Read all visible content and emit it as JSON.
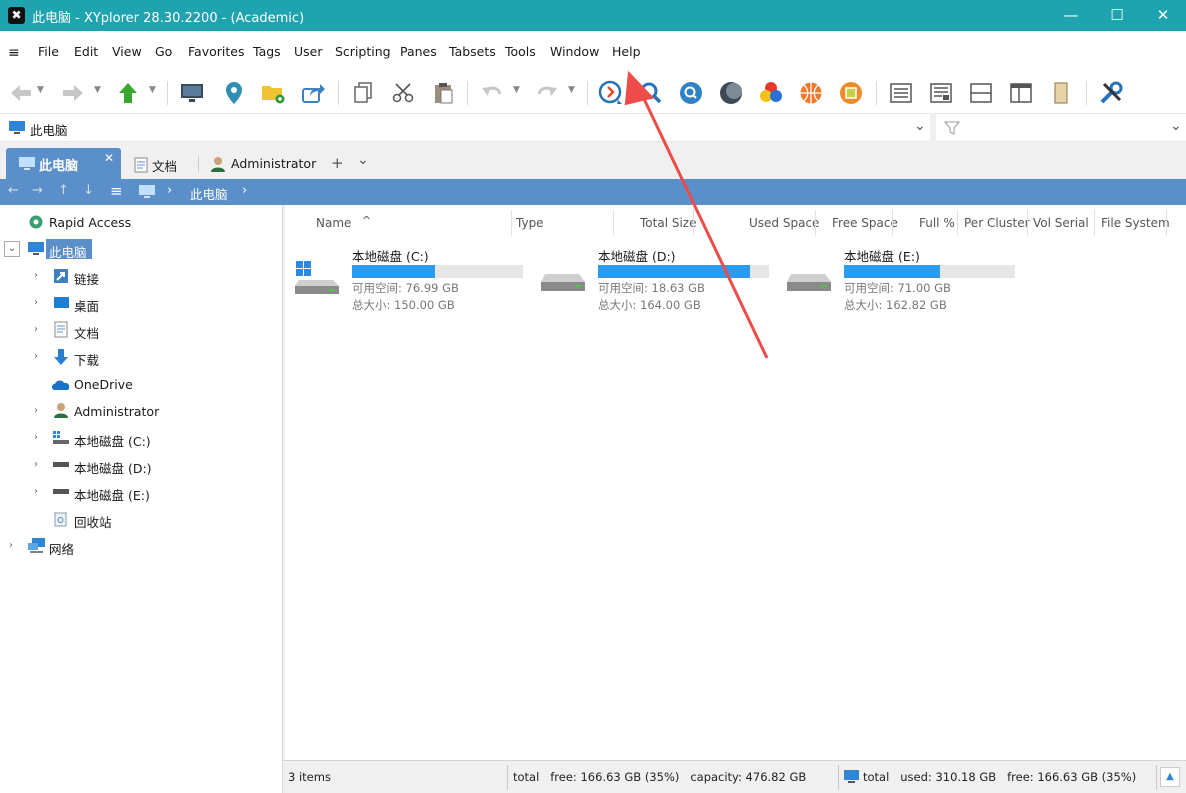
{
  "window": {
    "title": "此电脑 - XYplorer 28.30.2200 - (Academic)",
    "app_icon_glyph": "✖",
    "minimize": "—",
    "maximize": "☐",
    "close": "✕"
  },
  "menu": {
    "hamburger": "≡",
    "items": [
      "File",
      "Edit",
      "View",
      "Go",
      "Favorites",
      "Tags",
      "User",
      "Scripting",
      "Panes",
      "Tabsets",
      "Tools",
      "Window",
      "Help"
    ]
  },
  "address": {
    "path": "此电脑",
    "icon": "computer-icon",
    "dropdown": "⌄",
    "filter_icon": "filter-icon"
  },
  "tabs": [
    {
      "label": "此电脑",
      "icon": "computer-icon",
      "active": true,
      "close": "✕"
    },
    {
      "label": "文档",
      "icon": "document-icon",
      "active": false
    },
    {
      "label": "Administrator",
      "icon": "user-icon",
      "active": false
    }
  ],
  "tab_controls": {
    "add": "+",
    "more": "⌄"
  },
  "breadcrumb": {
    "back": "←",
    "forward": "→",
    "up": "↑",
    "down": "↓",
    "menu": "≡",
    "crumb": "此电脑",
    "sep1": "›",
    "sep2": "›"
  },
  "tree": {
    "rapid_access": "Rapid Access",
    "root": "此电脑",
    "children": [
      "链接",
      "桌面",
      "文档",
      "下载",
      "OneDrive",
      "Administrator",
      "本地磁盘 (C:)",
      "本地磁盘 (D:)",
      "本地磁盘 (E:)",
      "回收站"
    ],
    "network": "网络",
    "expand_glyph": "›",
    "collapse_glyph": "⌄"
  },
  "columns": [
    "Name",
    "Type",
    "Total Size",
    "Used Space",
    "Free Space",
    "Full %",
    "Per Cluster",
    "Vol Serial",
    "File System"
  ],
  "sort_indicator": "^",
  "drives": [
    {
      "name": "本地磁盘 (C:)",
      "free": "可用空间: 76.99 GB",
      "total": "总大小: 150.00 GB",
      "used_fraction": 0.487
    },
    {
      "name": "本地磁盘 (D:)",
      "free": "可用空间: 18.63 GB",
      "total": "总大小: 164.00 GB",
      "used_fraction": 0.886
    },
    {
      "name": "本地磁盘 (E:)",
      "free": "可用空间: 71.00 GB",
      "total": "总大小: 162.82 GB",
      "used_fraction": 0.564
    }
  ],
  "status": {
    "items": "3 items",
    "middle": "total   free: 166.63 GB (35%)   capacity: 476.82 GB",
    "right": "total   used: 310.18 GB   free: 166.63 GB (35%)",
    "scroll_up": "▲"
  },
  "colors": {
    "titlebar": "#1fa3ae",
    "tab_active": "#5b8fc9",
    "bar_fill": "#2b9bf0",
    "arrow": "#ee4b4b"
  }
}
